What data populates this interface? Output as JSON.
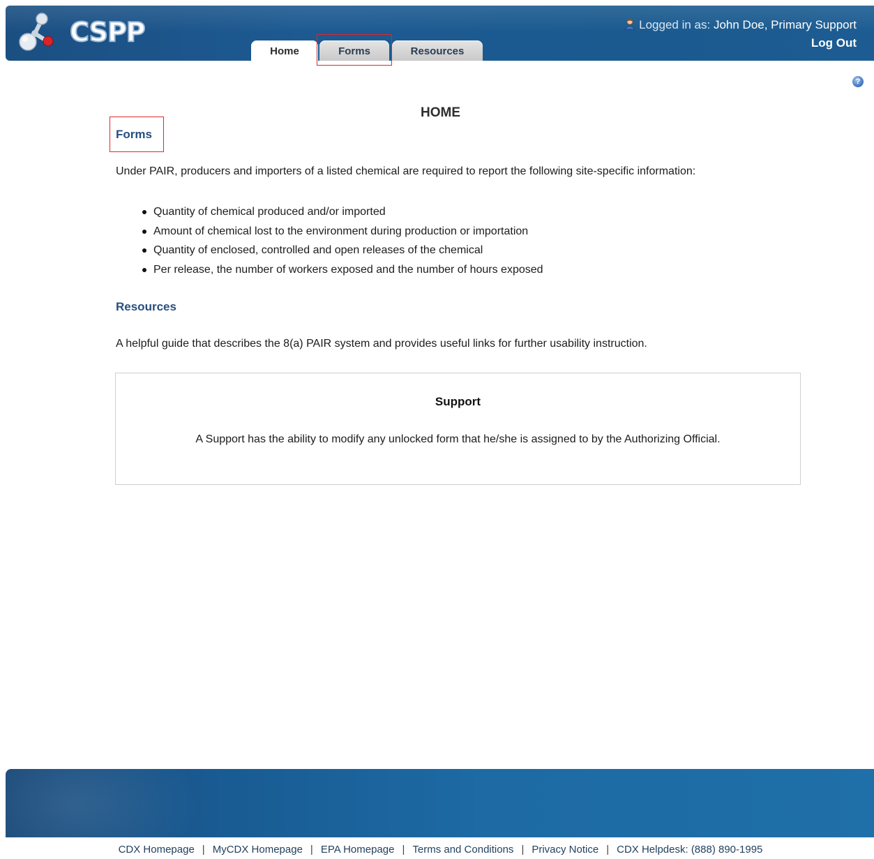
{
  "app": {
    "logo_text": "CSPP"
  },
  "header": {
    "logged_in_prefix": "Logged in as:",
    "user_name": "John Doe, Primary Support",
    "logout_label": "Log Out"
  },
  "tabs": [
    {
      "label": "Home",
      "active": true
    },
    {
      "label": "Forms",
      "active": false
    },
    {
      "label": "Resources",
      "active": false
    }
  ],
  "help": {
    "icon": "help-icon",
    "glyph": "?"
  },
  "main": {
    "title": "HOME",
    "forms": {
      "heading": "Forms",
      "intro": "Under PAIR, producers and importers of a listed chemical are required to report the following site-specific information:",
      "items": [
        "Quantity of chemical produced and/or imported",
        "Amount of chemical lost to the environment during production or importation",
        "Quantity of enclosed, controlled and open releases of the chemical",
        "Per release, the number of workers exposed and the number of hours exposed"
      ]
    },
    "resources": {
      "heading": "Resources",
      "text": "A helpful guide that describes the 8(a) PAIR system and provides useful links for further usability instruction."
    },
    "support": {
      "title": "Support",
      "text": "A Support has the ability to modify any unlocked form that he/she is assigned to by the Authorizing Official."
    }
  },
  "footer": {
    "links": [
      "CDX Homepage",
      "MyCDX Homepage",
      "EPA Homepage",
      "Terms and Conditions",
      "Privacy Notice",
      "CDX Helpdesk: (888) 890-1995"
    ],
    "separator": "|"
  },
  "colors": {
    "header_blue": "#1d5a92",
    "heading_blue": "#284e7e",
    "highlight_red": "#e0262b"
  }
}
